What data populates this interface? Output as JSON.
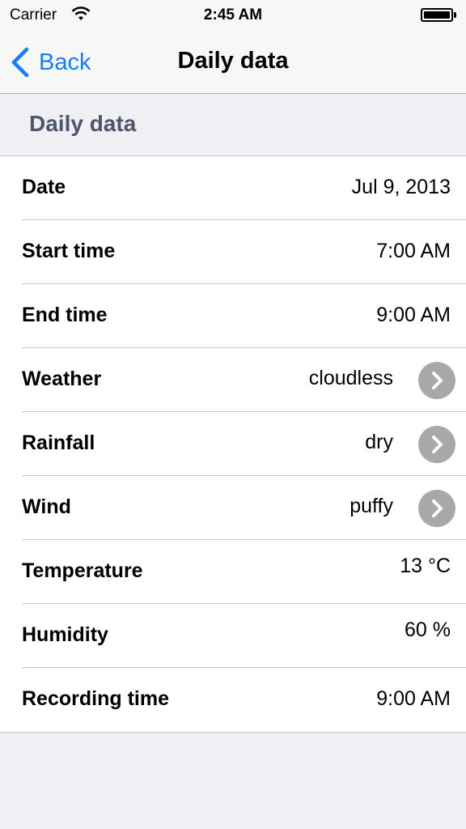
{
  "status_bar": {
    "carrier": "Carrier",
    "time": "2:45 AM"
  },
  "nav": {
    "back_label": "Back",
    "title": "Daily data",
    "accent_color": "#157efb"
  },
  "section": {
    "header": "Daily data"
  },
  "rows": [
    {
      "label": "Date",
      "value": "Jul 9, 2013"
    },
    {
      "label": "Start time",
      "value": "7:00 AM"
    },
    {
      "label": "End time",
      "value": "9:00 AM"
    },
    {
      "label": "Weather",
      "value": "cloudless",
      "disclosure": true
    },
    {
      "label": "Rainfall",
      "value": "dry",
      "disclosure": true
    },
    {
      "label": "Wind",
      "value": "puffy",
      "disclosure": true
    },
    {
      "label": "Temperature",
      "value": "13 °C"
    },
    {
      "label": "Humidity",
      "value": "60 %"
    },
    {
      "label": "Recording time",
      "value": "9:00 AM"
    }
  ]
}
